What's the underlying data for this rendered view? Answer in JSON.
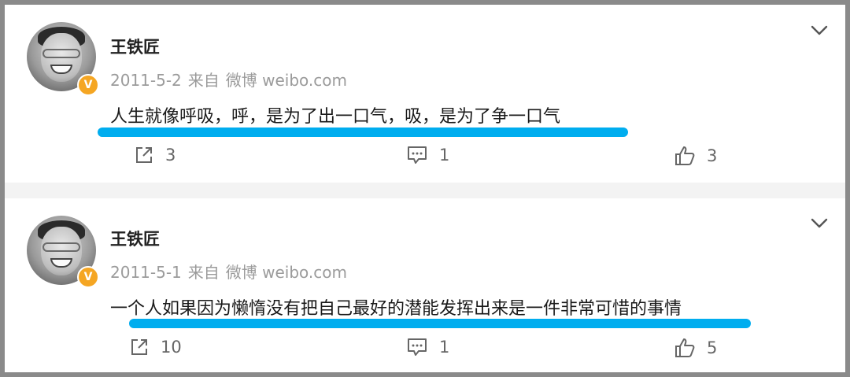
{
  "posts": [
    {
      "author": "王铁匠",
      "date": "2011-5-2",
      "source_prefix": "来自",
      "source": "微博 weibo.com",
      "verified_badge": "V",
      "content": "人生就像呼吸，呼，是为了出一口气，吸，是为了争一口气",
      "repost_count": "3",
      "comment_count": "1",
      "like_count": "3"
    },
    {
      "author": "王铁匠",
      "date": "2011-5-1",
      "source_prefix": "来自",
      "source": "微博 weibo.com",
      "verified_badge": "V",
      "content": "一个人如果因为懒惰没有把自己最好的潜能发挥出来是一件非常可惜的事情",
      "repost_count": "10",
      "comment_count": "1",
      "like_count": "5"
    }
  ],
  "colors": {
    "highlight": "#00adef",
    "verified": "#f5a623",
    "meta_text": "#9b9b9b"
  },
  "icons": [
    "chevron-down-icon",
    "repost-icon",
    "comment-icon",
    "thumbs-up-icon"
  ]
}
